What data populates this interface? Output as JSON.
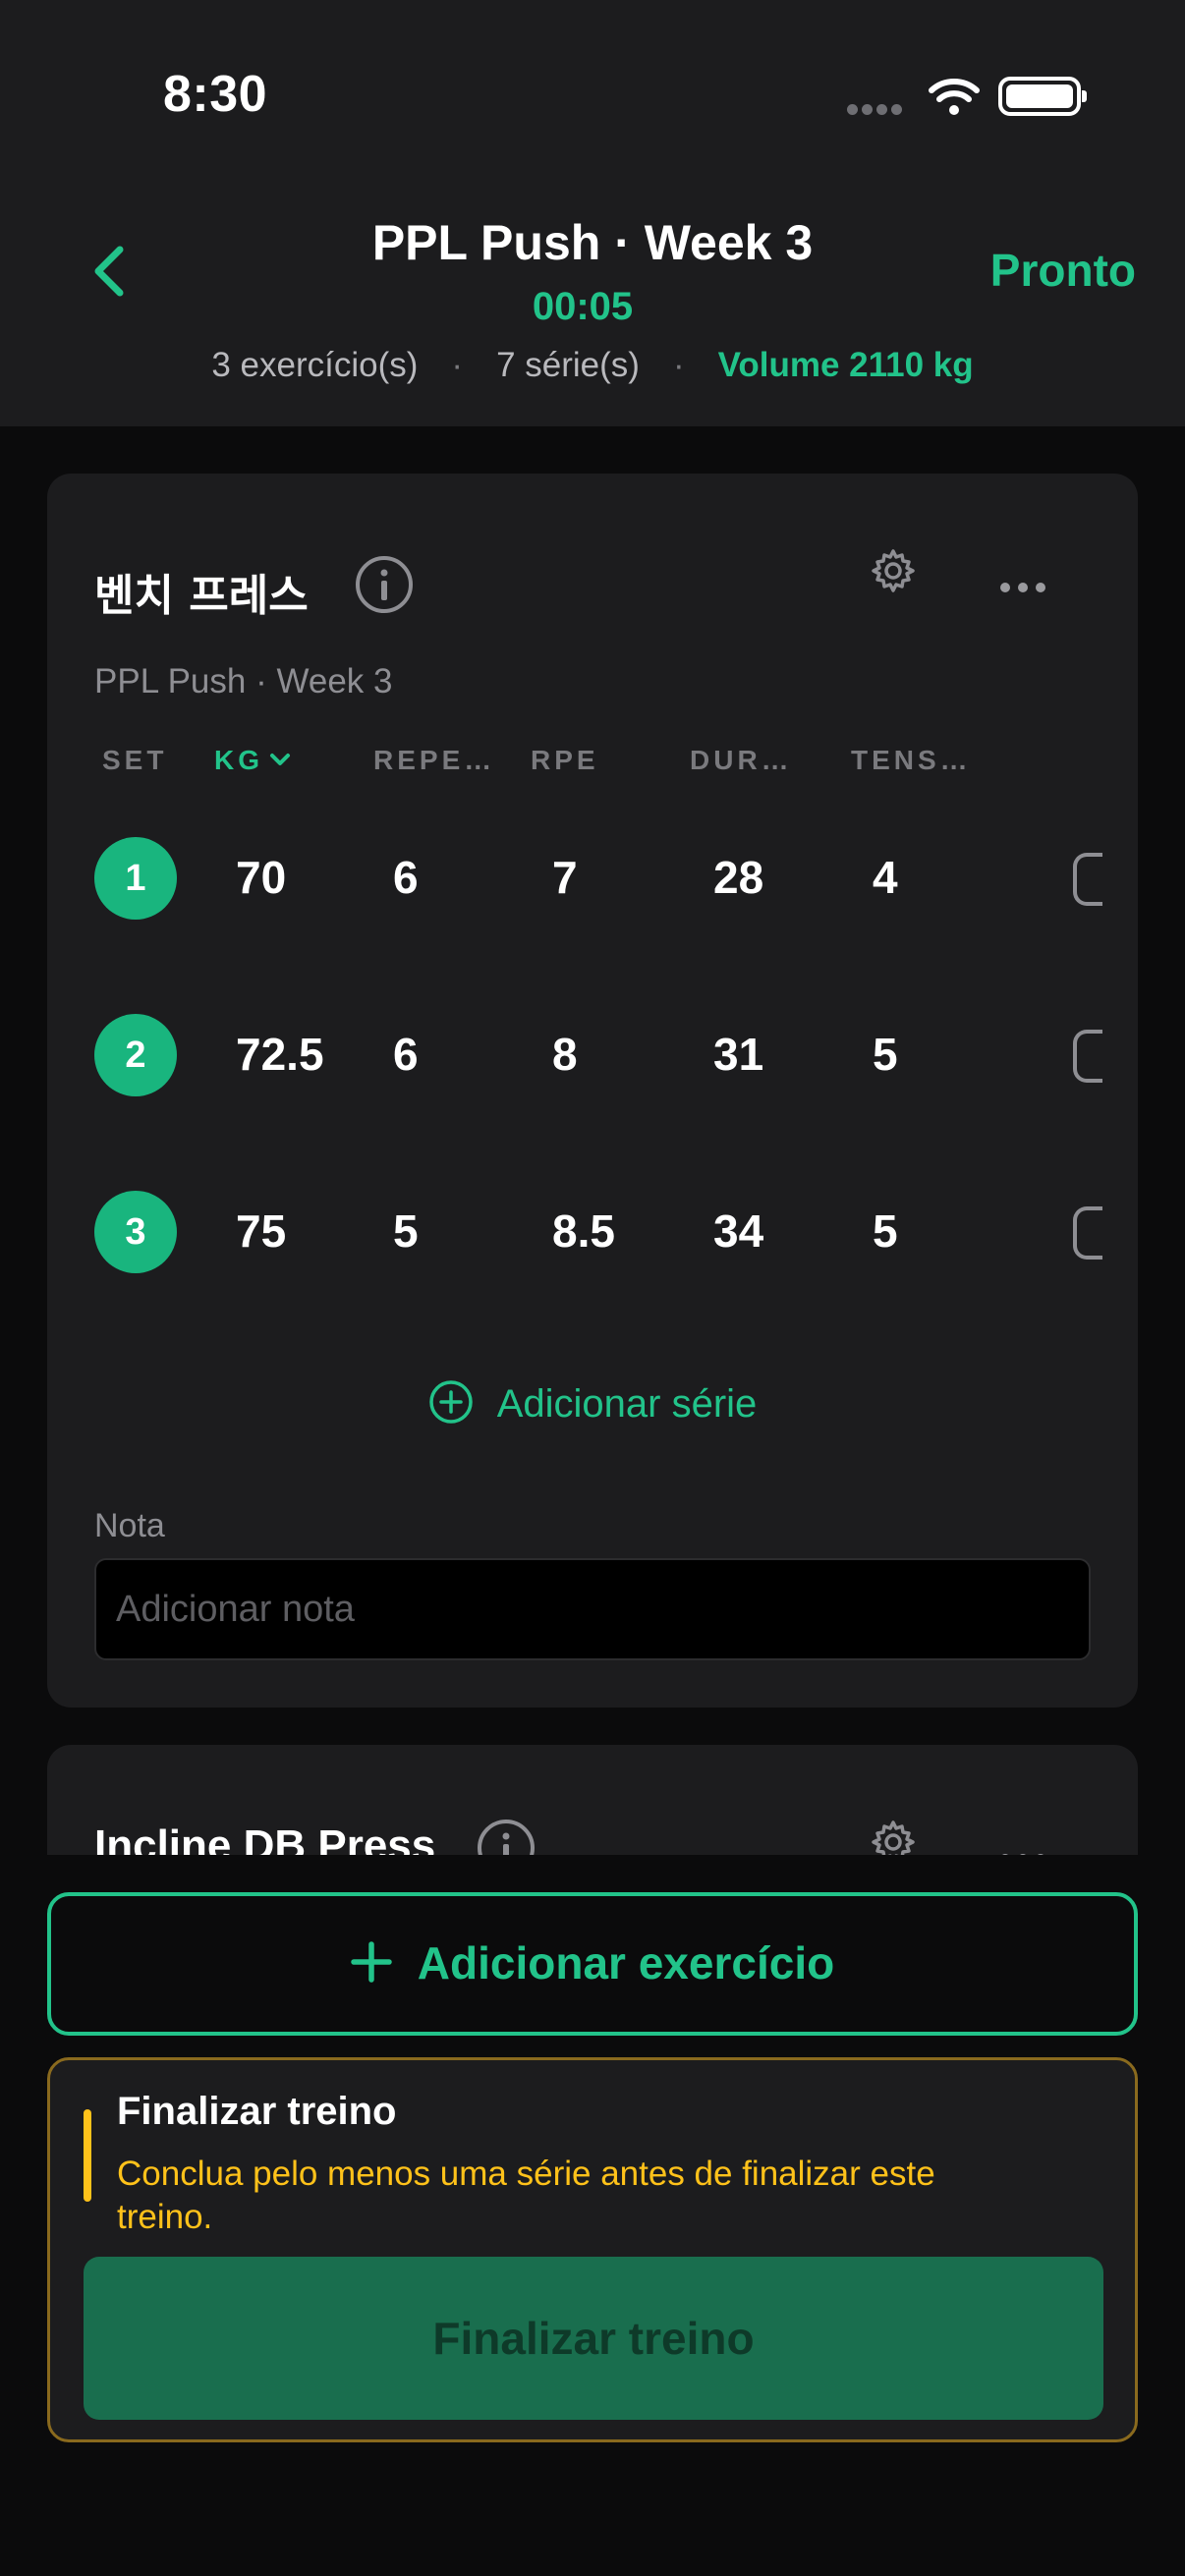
{
  "status_bar": {
    "time": "8:30"
  },
  "header": {
    "title": "PPL Push · Week 3",
    "timer": "00:05",
    "done_label": "Pronto",
    "exercise_count": "3 exercício(s)",
    "set_count": "7 série(s)",
    "volume": "Volume 2110 kg",
    "separator": "·"
  },
  "exercises": [
    {
      "name": "벤치 프레스",
      "subtitle": "PPL Push · Week 3",
      "columns": [
        "SET",
        "KG",
        "REPE…",
        "RPE",
        "DUR…",
        "TENS…"
      ],
      "sets": [
        {
          "set": "1",
          "kg": "70",
          "reps": "6",
          "rpe": "7",
          "duration": "28",
          "tension": "4"
        },
        {
          "set": "2",
          "kg": "72.5",
          "reps": "6",
          "rpe": "8",
          "duration": "31",
          "tension": "5"
        },
        {
          "set": "3",
          "kg": "75",
          "reps": "5",
          "rpe": "8.5",
          "duration": "34",
          "tension": "5"
        }
      ],
      "add_set_label": "Adicionar série",
      "note_label": "Nota",
      "note_placeholder": "Adicionar nota"
    },
    {
      "name": "Incline DB Press"
    }
  ],
  "bottom": {
    "add_exercise_label": "Adicionar exercício",
    "finish_title": "Finalizar treino",
    "finish_message": "Conclua pelo menos uma série antes de finalizar este treino.",
    "finish_button_label": "Finalizar treino"
  },
  "colors": {
    "accent": "#22c38a",
    "warning": "#ffc21a",
    "card": "#1c1c1e",
    "background": "#0b0b0c"
  },
  "icons": [
    "back-chevron-icon",
    "info-icon",
    "gear-icon",
    "more-icon",
    "plus-circle-icon",
    "plus-icon",
    "wifi-icon",
    "battery-icon",
    "signal-icon"
  ]
}
